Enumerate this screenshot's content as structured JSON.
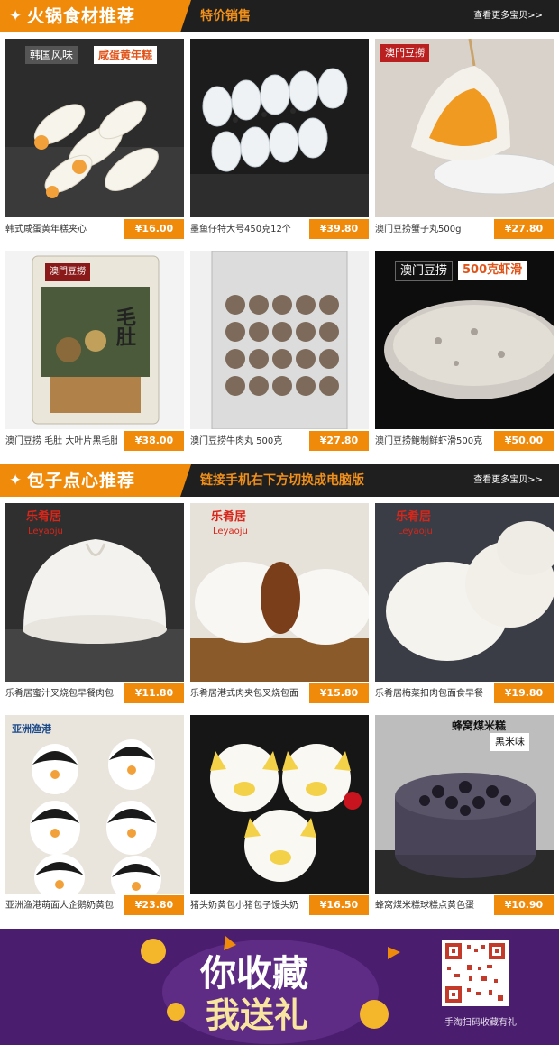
{
  "sections": [
    {
      "title": "火锅食材推荐",
      "tag": "特价销售",
      "more": "查看更多宝贝>>",
      "products": [
        {
          "name": "韩式咸蛋黄年糕夹心",
          "price": "¥16.00",
          "badge_left": "韩国风味",
          "badge_right": "咸蛋黄年糕",
          "icon": "rice-cake-icon"
        },
        {
          "name": "墨鱼仔特大号450克12个",
          "price": "¥39.80",
          "icon": "cuttlefish-icon"
        },
        {
          "name": "澳门豆捞蟹子丸500g",
          "price": "¥27.80",
          "badge_left": "澳門豆撈",
          "icon": "crab-roe-ball-icon"
        },
        {
          "name": "澳门豆捞 毛肚 大叶片黑毛肚",
          "price": "¥38.00",
          "badge_left": "澳門豆撈",
          "badge_right": "毛肚",
          "icon": "tripe-package-icon"
        },
        {
          "name": "澳门豆捞牛肉丸 500克",
          "price": "¥27.80",
          "icon": "beef-ball-package-icon"
        },
        {
          "name": "澳门豆捞鲍制鲜虾滑500克",
          "price": "¥50.00",
          "badge_left": "澳门豆捞",
          "badge_right": "500克虾滑",
          "icon": "shrimp-paste-icon"
        }
      ]
    },
    {
      "title": "包子点心推荐",
      "tag": "链接手机右下方切换成电脑版",
      "more": "查看更多宝贝>>",
      "products": [
        {
          "name": "乐肴居蜜汁叉烧包早餐肉包",
          "price": "¥11.80",
          "badge_left": "乐肴居",
          "badge_sub": "Leyaoju",
          "icon": "char-siu-bun-icon"
        },
        {
          "name": "乐肴居港式肉夹包叉烧包面",
          "price": "¥15.80",
          "badge_left": "乐肴居",
          "badge_sub": "Leyaoju",
          "icon": "pork-sandwich-bun-icon"
        },
        {
          "name": "乐肴居梅菜扣肉包面食早餐",
          "price": "¥19.80",
          "badge_left": "乐肴居",
          "badge_sub": "Leyaoju",
          "icon": "folded-bun-icon"
        },
        {
          "name": "亚洲渔港萌面人企鹅奶黄包",
          "price": "¥23.80",
          "badge_left": "亚洲渔港",
          "icon": "penguin-bun-icon"
        },
        {
          "name": "猪头奶黄包小猪包子馒头奶",
          "price": "¥16.50",
          "icon": "piggy-bun-icon"
        },
        {
          "name": "蜂窝煤米糕球糕点黄色蛋",
          "price": "¥10.90",
          "badge_left": "蜂窝煤米糕",
          "badge_right": "黑米味",
          "icon": "honeycomb-cake-icon"
        }
      ]
    }
  ],
  "banner": {
    "line1": "你收藏",
    "line2": "我送礼",
    "qr_caption": "手淘扫码收藏有礼",
    "colors": {
      "background": "#4a1d6e",
      "accent": "#f08a0a"
    }
  }
}
